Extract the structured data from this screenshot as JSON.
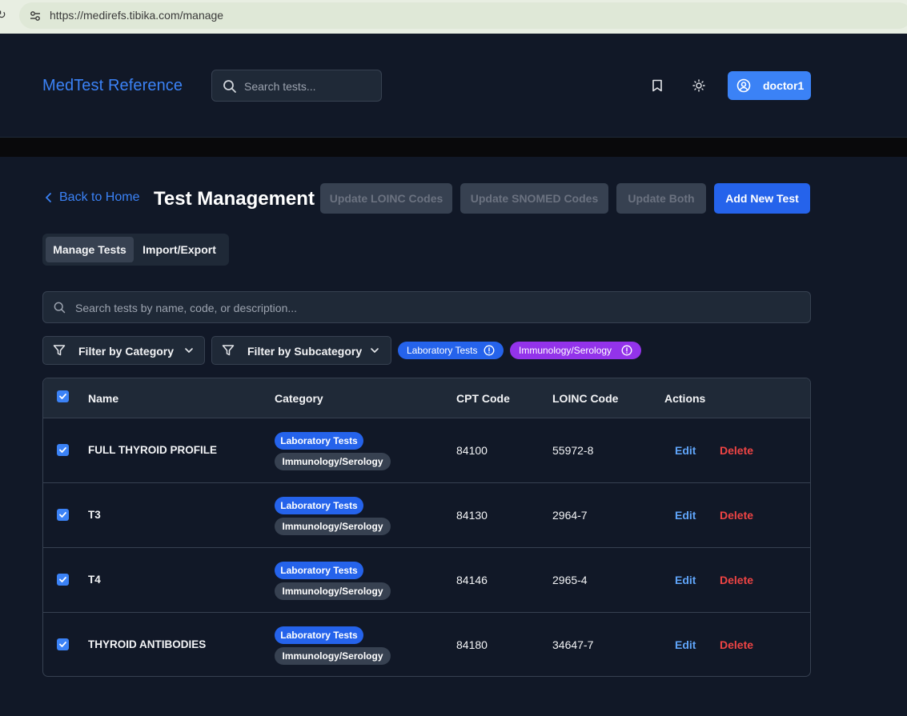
{
  "browser": {
    "url": "https://medirefs.tibika.com/manage"
  },
  "header": {
    "brand": "MedTest Reference",
    "search_placeholder": "Search tests...",
    "user_label": "doctor1"
  },
  "toolbar": {
    "back_label": "Back to Home",
    "title": "Test Management",
    "update_loinc": "Update LOINC Codes",
    "update_snomed": "Update SNOMED Codes",
    "update_both": "Update Both",
    "add_new": "Add New Test"
  },
  "tabs": [
    {
      "label": "Manage Tests",
      "active": true
    },
    {
      "label": "Import/Export",
      "active": false
    }
  ],
  "search": {
    "placeholder": "Search tests by name, code, or description..."
  },
  "filters": {
    "category_label": "Filter by Category",
    "subcategory_label": "Filter by Subcategory",
    "active_chips": [
      "Laboratory Tests",
      "Immunology/Serology"
    ]
  },
  "table": {
    "headers": [
      "Name",
      "Category",
      "CPT Code",
      "LOINC Code",
      "Actions"
    ],
    "edit_label": "Edit",
    "delete_label": "Delete",
    "rows": [
      {
        "name": "FULL THYROID PROFILE",
        "category": "Laboratory Tests",
        "subcategory": "Immunology/Serology",
        "cpt": "84100",
        "loinc": "55972-8"
      },
      {
        "name": "T3",
        "category": "Laboratory Tests",
        "subcategory": "Immunology/Serology",
        "cpt": "84130",
        "loinc": "2964-7"
      },
      {
        "name": "T4",
        "category": "Laboratory Tests",
        "subcategory": "Immunology/Serology",
        "cpt": "84146",
        "loinc": "2965-4"
      },
      {
        "name": "THYROID ANTIBODIES",
        "category": "Laboratory Tests",
        "subcategory": "Immunology/Serology",
        "cpt": "84180",
        "loinc": "34647-7"
      }
    ]
  },
  "colors": {
    "background": "#111827",
    "panel": "#1f2937",
    "accent": "#3b82f6",
    "primary_button": "#2563eb",
    "chip_purple": "#9333ea",
    "delete": "#ef4444"
  }
}
